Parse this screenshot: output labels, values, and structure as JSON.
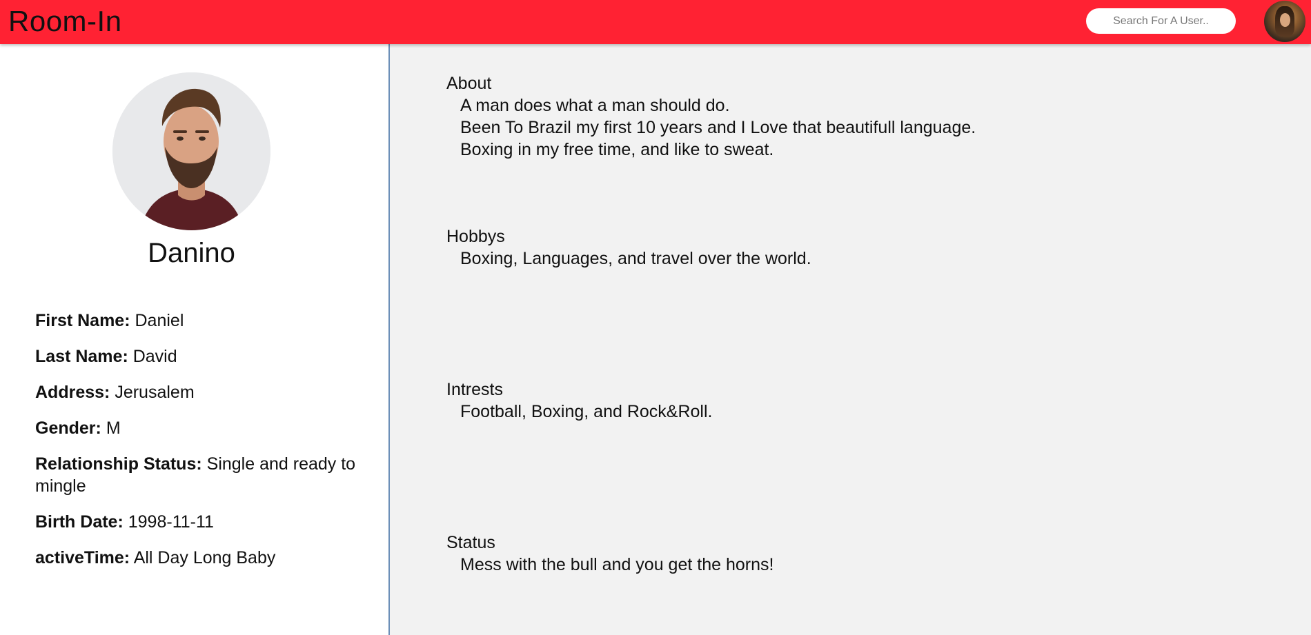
{
  "header": {
    "brand": "Room-In",
    "search_placeholder": "Search For A User..",
    "accent_color": "#ff2233"
  },
  "profile": {
    "username": "Danino",
    "fields": [
      {
        "label": "First Name:",
        "value": "Daniel"
      },
      {
        "label": "Last Name:",
        "value": "David"
      },
      {
        "label": "Address:",
        "value": "Jerusalem"
      },
      {
        "label": "Gender:",
        "value": "M"
      },
      {
        "label": "Relationship Status:",
        "value": "Single and ready to mingle"
      },
      {
        "label": "Birth Date:",
        "value": "1998-11-11"
      },
      {
        "label": "activeTime:",
        "value": "All Day Long Baby"
      }
    ]
  },
  "sections": {
    "about": {
      "title": "About",
      "lines": [
        "A man does what a man should do.",
        "Been To Brazil my first 10 years and I Love that beautifull language.",
        "Boxing in my free time, and like to sweat."
      ]
    },
    "hobbys": {
      "title": "Hobbys",
      "lines": [
        "Boxing, Languages, and travel over the world."
      ]
    },
    "intrests": {
      "title": "Intrests",
      "lines": [
        "Football, Boxing, and Rock&Roll."
      ]
    },
    "status": {
      "title": "Status",
      "lines": [
        "Mess with the bull and you get the horns!"
      ]
    }
  }
}
